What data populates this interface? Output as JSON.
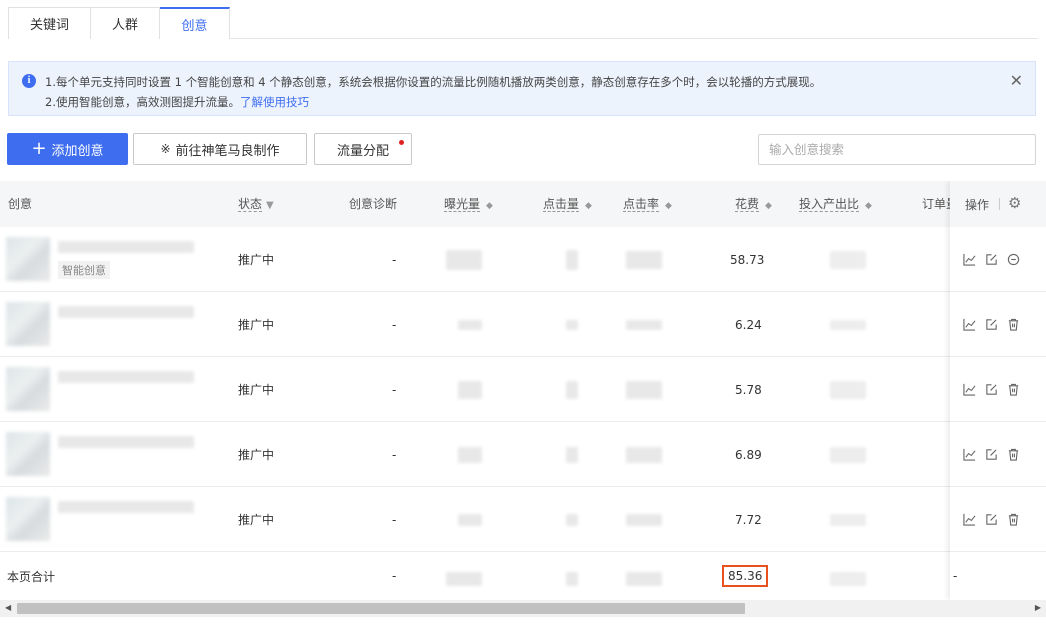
{
  "tabs": [
    {
      "label": "关键词"
    },
    {
      "label": "人群"
    },
    {
      "label": "创意"
    }
  ],
  "notice": {
    "line1": "1.每个单元支持同时设置 1 个智能创意和 4 个静态创意，系统会根据你设置的流量比例随机播放两类创意，静态创意存在多个时，会以轮播的方式展现。",
    "line2_prefix": "2.使用智能创意，高效测图提升流量。",
    "line2_link": "了解使用技巧"
  },
  "toolbar": {
    "add_label": "添加创意",
    "brush_label": "前往神笔马良制作",
    "flow_label": "流量分配",
    "search_placeholder": "输入创意搜索"
  },
  "columns": {
    "creative": "创意",
    "status": "状态",
    "diagnosis": "创意诊断",
    "impressions": "曝光量",
    "clicks": "点击量",
    "ctr": "点击率",
    "cost": "花费",
    "roi": "投入产出比",
    "orders": "订单量",
    "ops": "操作"
  },
  "rows": [
    {
      "tag": "智能创意",
      "status": "推广中",
      "diagnosis": "-",
      "cost": "58.73"
    },
    {
      "tag": "",
      "status": "推广中",
      "diagnosis": "-",
      "cost": "6.24"
    },
    {
      "tag": "",
      "status": "推广中",
      "diagnosis": "-",
      "cost": "5.78"
    },
    {
      "tag": "",
      "status": "推广中",
      "diagnosis": "-",
      "cost": "6.89"
    },
    {
      "tag": "",
      "status": "推广中",
      "diagnosis": "-",
      "cost": "7.72"
    }
  ],
  "summary": {
    "label": "本页合计",
    "diagnosis": "-",
    "cost": "85.36",
    "ops": "-"
  },
  "colors": {
    "primary": "#3e6df0",
    "highlight": "#e8501e"
  }
}
